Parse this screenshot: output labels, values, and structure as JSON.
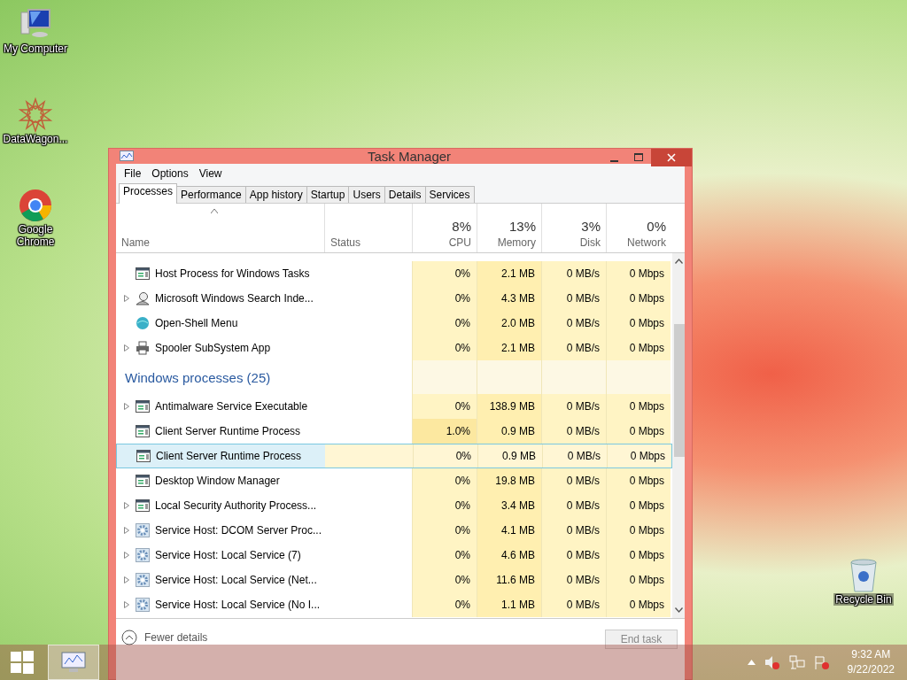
{
  "desktop_icons": [
    {
      "label": "My Computer",
      "kind": "computer"
    },
    {
      "label": "DataWagon...",
      "kind": "star"
    },
    {
      "label": "Google Chrome",
      "kind": "chrome"
    },
    {
      "label": "Recycle Bin",
      "kind": "bin"
    }
  ],
  "window": {
    "title": "Task Manager"
  },
  "menu": [
    "File",
    "Options",
    "View"
  ],
  "tabs": [
    {
      "label": "Processes",
      "selected": true
    },
    {
      "label": "Performance",
      "selected": false
    },
    {
      "label": "App history",
      "selected": false
    },
    {
      "label": "Startup",
      "selected": false
    },
    {
      "label": "Users",
      "selected": false
    },
    {
      "label": "Details",
      "selected": false
    },
    {
      "label": "Services",
      "selected": false
    }
  ],
  "table": {
    "columns": [
      {
        "label": "Name"
      },
      {
        "label": "Status"
      },
      {
        "percent": "8%",
        "label": "CPU"
      },
      {
        "percent": "13%",
        "label": "Memory"
      },
      {
        "percent": "3%",
        "label": "Disk"
      },
      {
        "percent": "0%",
        "label": "Network"
      }
    ],
    "rows": [
      {
        "kind": "window",
        "expandable": false,
        "selected": false,
        "name": "Host Process for Windows Tasks",
        "cpu": "0%",
        "memory": "2.1 MB",
        "disk": "0 MB/s",
        "network": "0 Mbps"
      },
      {
        "kind": "search",
        "expandable": true,
        "selected": false,
        "name": "Microsoft Windows Search Inde...",
        "cpu": "0%",
        "memory": "4.3 MB",
        "disk": "0 MB/s",
        "network": "0 Mbps"
      },
      {
        "kind": "shell",
        "expandable": false,
        "selected": false,
        "name": "Open-Shell Menu",
        "cpu": "0%",
        "memory": "2.0 MB",
        "disk": "0 MB/s",
        "network": "0 Mbps"
      },
      {
        "kind": "printer",
        "expandable": true,
        "selected": false,
        "name": "Spooler SubSystem App",
        "cpu": "0%",
        "memory": "2.1 MB",
        "disk": "0 MB/s",
        "network": "0 Mbps"
      },
      {
        "kind": "group",
        "name": "Windows processes (25)"
      },
      {
        "kind": "window",
        "expandable": true,
        "selected": false,
        "name": "Antimalware Service Executable",
        "cpu": "0%",
        "memory": "138.9 MB",
        "disk": "0 MB/s",
        "network": "0 Mbps"
      },
      {
        "kind": "window",
        "expandable": false,
        "selected": false,
        "name": "Client Server Runtime Process",
        "cpu": "1.0%",
        "memory": "0.9 MB",
        "disk": "0 MB/s",
        "network": "0 Mbps"
      },
      {
        "kind": "window",
        "expandable": false,
        "selected": true,
        "name": "Client Server Runtime Process",
        "cpu": "0%",
        "memory": "0.9 MB",
        "disk": "0 MB/s",
        "network": "0 Mbps"
      },
      {
        "kind": "window",
        "expandable": false,
        "selected": false,
        "name": "Desktop Window Manager",
        "cpu": "0%",
        "memory": "19.8 MB",
        "disk": "0 MB/s",
        "network": "0 Mbps"
      },
      {
        "kind": "window",
        "expandable": true,
        "selected": false,
        "name": "Local Security Authority Process...",
        "cpu": "0%",
        "memory": "3.4 MB",
        "disk": "0 MB/s",
        "network": "0 Mbps"
      },
      {
        "kind": "gear",
        "expandable": true,
        "selected": false,
        "name": "Service Host: DCOM Server Proc...",
        "cpu": "0%",
        "memory": "4.1 MB",
        "disk": "0 MB/s",
        "network": "0 Mbps"
      },
      {
        "kind": "gear",
        "expandable": true,
        "selected": false,
        "name": "Service Host: Local Service (7)",
        "cpu": "0%",
        "memory": "4.6 MB",
        "disk": "0 MB/s",
        "network": "0 Mbps"
      },
      {
        "kind": "gear",
        "expandable": true,
        "selected": false,
        "name": "Service Host: Local Service (Net...",
        "cpu": "0%",
        "memory": "11.6 MB",
        "disk": "0 MB/s",
        "network": "0 Mbps"
      },
      {
        "kind": "gear",
        "expandable": true,
        "selected": false,
        "name": "Service Host: Local Service (No I...",
        "cpu": "0%",
        "memory": "1.1 MB",
        "disk": "0 MB/s",
        "network": "0 Mbps"
      }
    ]
  },
  "footer": {
    "details_link": "Fewer details",
    "end_task": {
      "label": "End task",
      "disabled": true
    }
  },
  "taskbar": {
    "time": "9:32 AM",
    "date": "9/22/2022"
  }
}
